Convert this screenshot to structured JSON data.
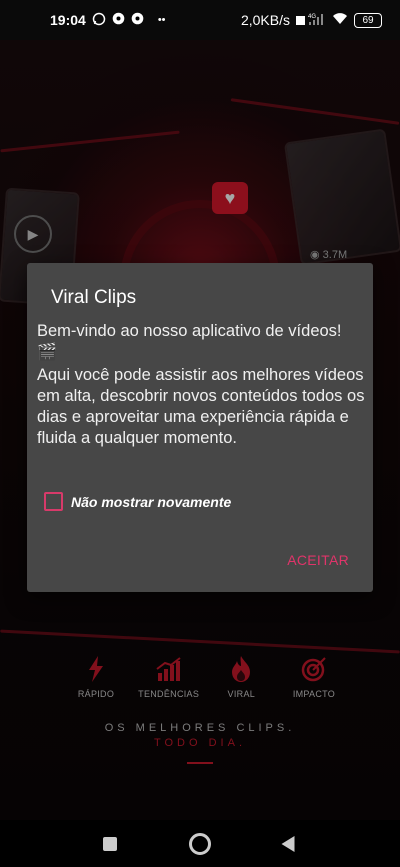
{
  "status_bar": {
    "time": "19:04",
    "notif_icons": [
      "whatsapp-icon",
      "soccer-ball-icon",
      "soccer-ball-icon",
      "more-dots-icon"
    ],
    "network_speed": "2,0KB/s",
    "network_type": "4G",
    "battery": "69"
  },
  "background": {
    "views_count": "3.7M",
    "features": [
      {
        "icon": "lightning-icon",
        "label": "RÁPIDO"
      },
      {
        "icon": "trend-chart-icon",
        "label": "TENDÊNCIAS"
      },
      {
        "icon": "flame-icon",
        "label": "VIRAL"
      },
      {
        "icon": "target-icon",
        "label": "IMPACTO"
      }
    ],
    "tagline_main": "OS MELHORES CLIPS.",
    "tagline_accent": "TODO DIA."
  },
  "dialog": {
    "title": "Viral Clips",
    "message_line1": "Bem-vindo ao nosso aplicativo de vídeos!",
    "clapper": "🎬",
    "message_body": "Aqui você pode assistir aos melhores vídeos em alta, descobrir novos conteúdos todos os dias e aproveitar uma experiência rápida e fluida a qualquer momento.",
    "checkbox_label": "Não mostrar novamente",
    "checkbox_checked": false,
    "accept_label": "ACEITAR"
  },
  "colors": {
    "accent": "#e0346a",
    "brand_red": "#c8192c",
    "dialog_bg": "#474747"
  }
}
